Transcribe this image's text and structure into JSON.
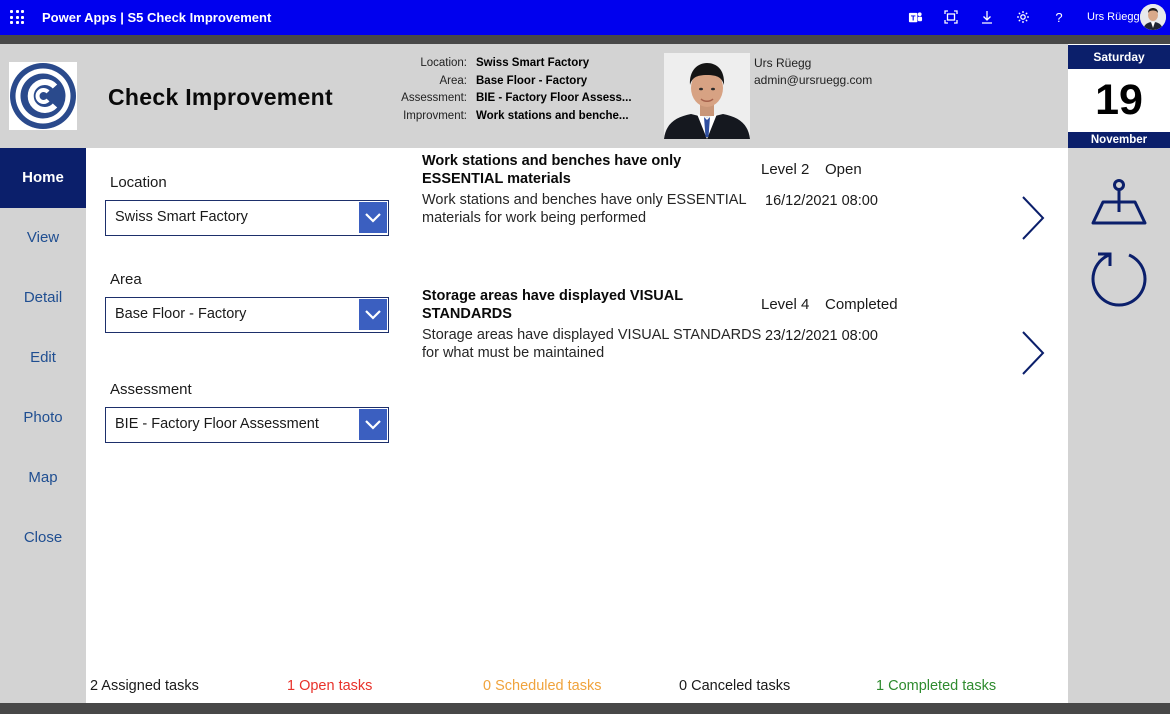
{
  "topbar": {
    "app_title": "Power Apps  |  S5 Check Improvement",
    "user_name": "Urs Rüegg",
    "help_glyph": "?",
    "icons": [
      "waffle-icon",
      "teams-icon",
      "fit-to-screen-icon",
      "download-icon",
      "settings-icon",
      "help-icon"
    ]
  },
  "header": {
    "title": "Check Improvement",
    "info_labels": {
      "location": "Location:",
      "area": "Area:",
      "assessment": "Assessment:",
      "improvement": "Improvment:"
    },
    "info_values": {
      "location": "Swiss Smart Factory",
      "area": "Base Floor - Factory",
      "assessment": "BIE - Factory Floor Assess...",
      "improvement": "Work stations and benche..."
    },
    "user_name": "Urs Rüegg",
    "user_email": "admin@ursruegg.com"
  },
  "date": {
    "day_name": "Saturday",
    "day": "19",
    "month": "November"
  },
  "nav": {
    "items": [
      "Home",
      "View",
      "Detail",
      "Edit",
      "Photo",
      "Map",
      "Close"
    ],
    "active": "Home"
  },
  "form": {
    "location_label": "Location",
    "location_value": "Swiss Smart Factory",
    "area_label": "Area",
    "area_value": "Base Floor - Factory",
    "assessment_label": "Assessment",
    "assessment_value": "BIE - Factory Floor Assessment"
  },
  "gallery": [
    {
      "title": "Work stations and benches have only ESSENTIAL materials",
      "description": "Work stations and benches have only ESSENTIAL materials for work being performed",
      "level": "Level 2",
      "status": "Open",
      "date": "16/12/2021 08:00"
    },
    {
      "title": "Storage areas have displayed VISUAL STANDARDS",
      "description": "Storage areas have displayed VISUAL STANDARDS for what must be maintained",
      "level": "Level 4",
      "status": "Completed",
      "date": "23/12/2021 08:00"
    }
  ],
  "footer": {
    "assigned": "2 Assigned tasks",
    "open": "1 Open tasks",
    "scheduled": "0 Scheduled tasks",
    "canceled": "0 Canceled tasks",
    "completed": "1 Completed tasks"
  },
  "colors": {
    "suite_bar": "#0000ee",
    "navy": "#0b1f6b",
    "nav_text": "#1f4e91",
    "dropdown_button": "#3b5fc0",
    "panel_gray": "#d3d3d3",
    "open": "#e8322b",
    "scheduled": "#f0a33c",
    "completed": "#2e8b2e"
  }
}
